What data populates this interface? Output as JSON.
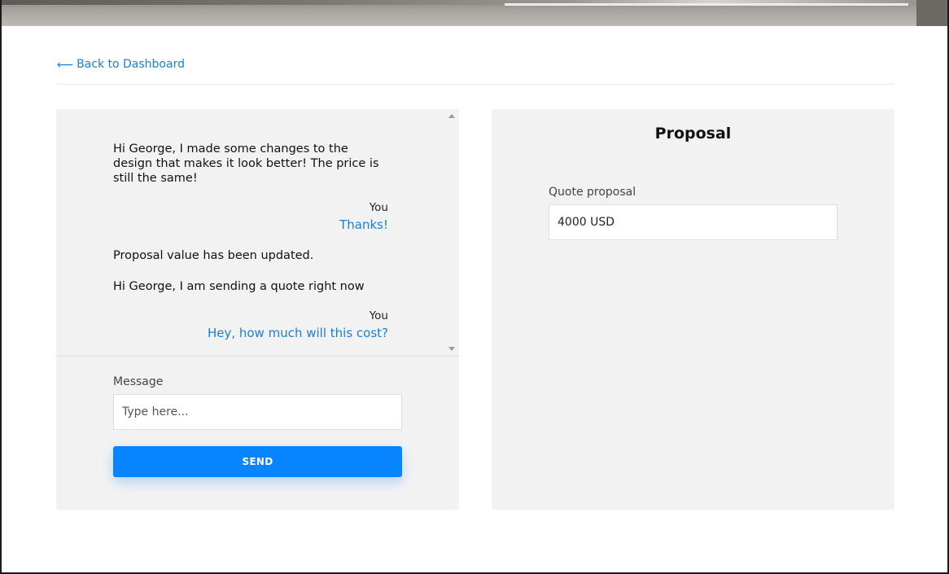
{
  "nav": {
    "back_arrow": "⟵",
    "back_label": "Back to Dashboard"
  },
  "chat": {
    "messages": [
      {
        "sender": "",
        "text": "Hi George, I made some changes to the design that makes it look better! The price is still the same!"
      },
      {
        "sender": "You",
        "text": "Thanks!"
      },
      {
        "sender": "",
        "text": "Proposal value has been updated."
      },
      {
        "sender": "",
        "text": "Hi George, I am sending a quote right now"
      },
      {
        "sender": "You",
        "text": "Hey, how much will this cost?"
      }
    ],
    "message_label": "Message",
    "message_placeholder": "Type here...",
    "message_value": "",
    "send_label": "SEND"
  },
  "proposal": {
    "title": "Proposal",
    "quote_label": "Quote proposal",
    "quote_value": "4000 USD"
  },
  "colors": {
    "accent": "#0984ff",
    "link": "#1a7fd9",
    "panel_bg": "#f2f2f2"
  }
}
